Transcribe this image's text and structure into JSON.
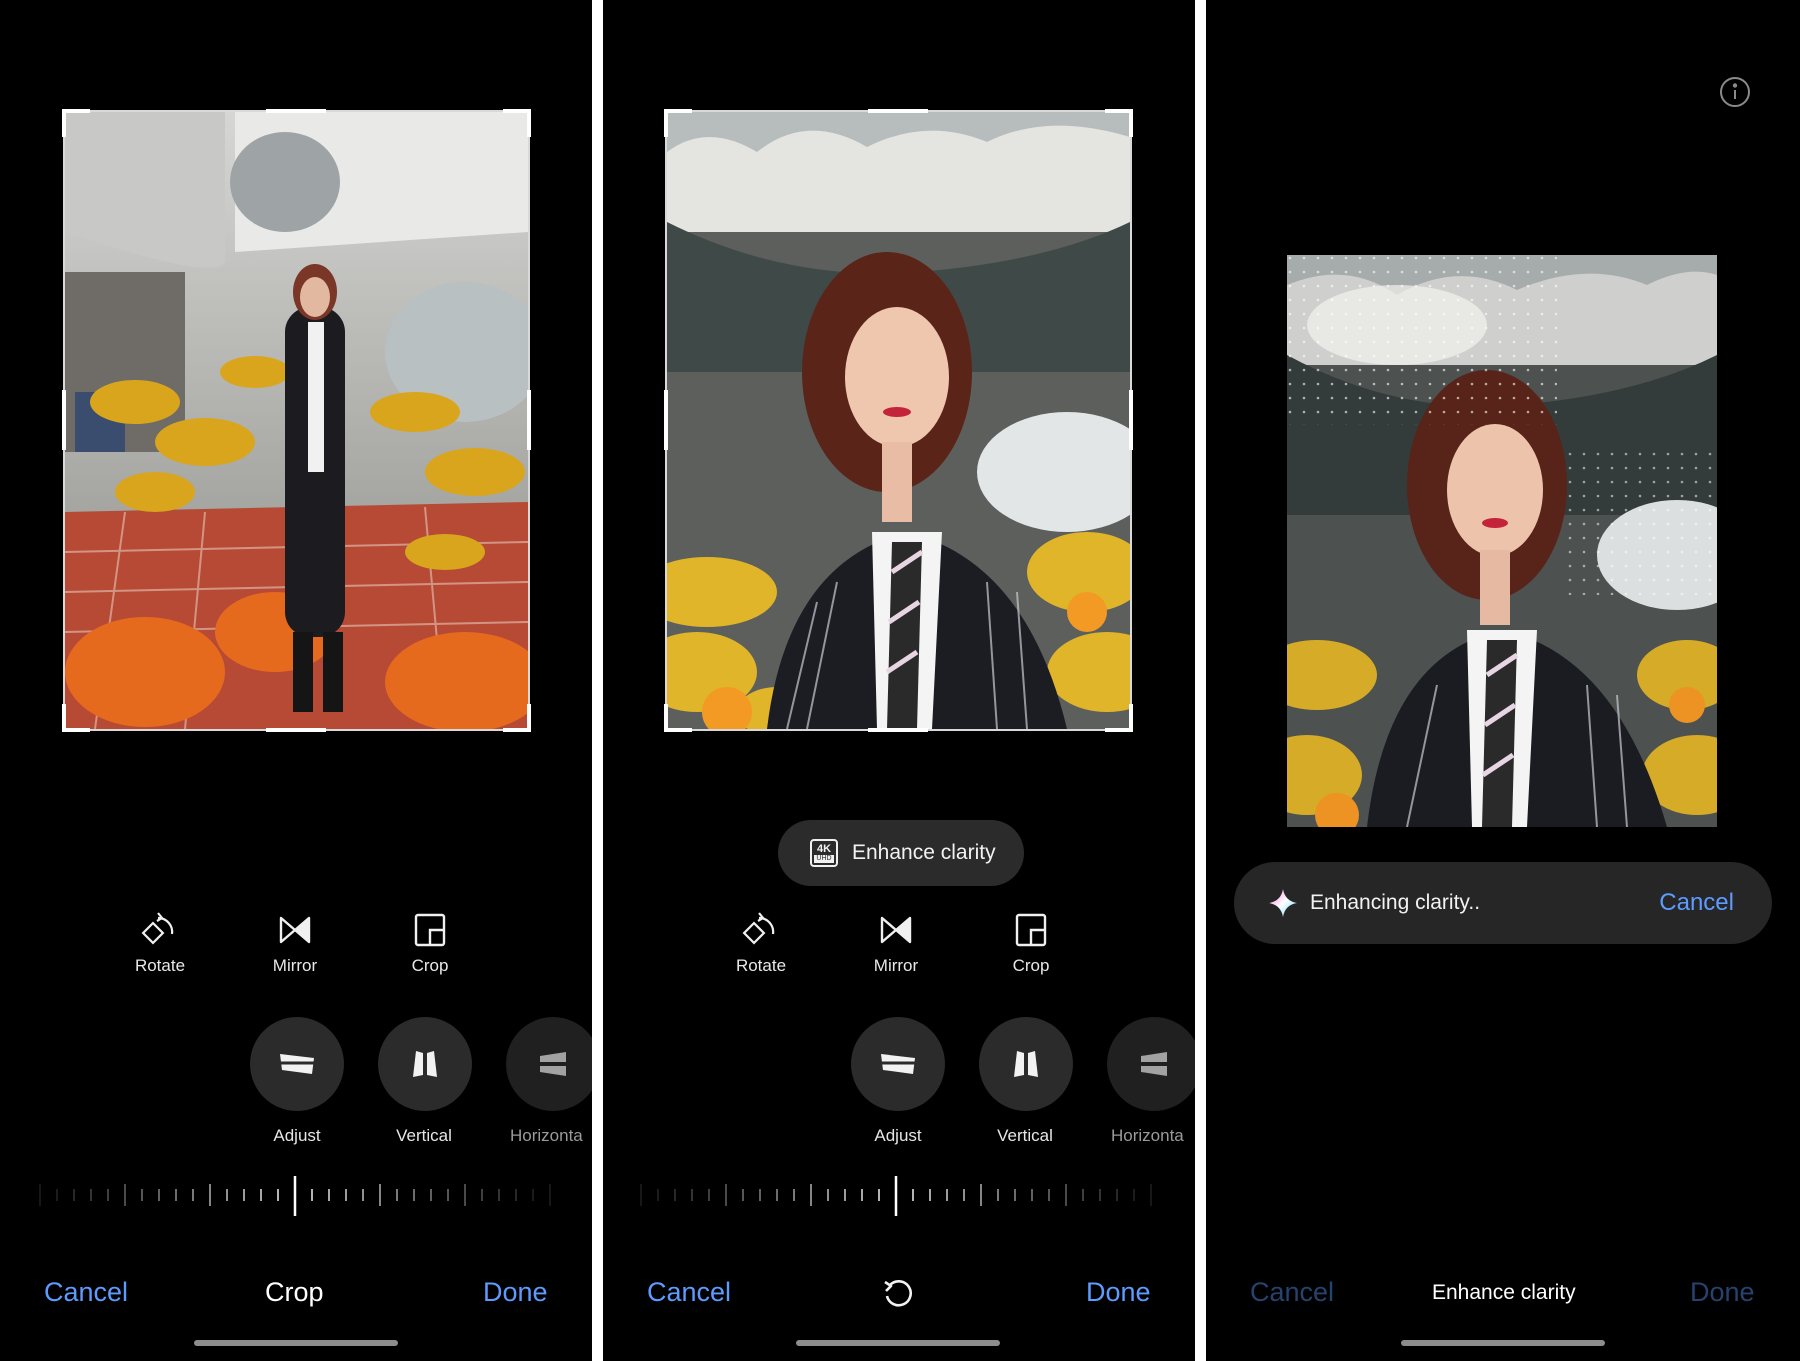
{
  "panel1": {
    "tools": {
      "rotate": "Rotate",
      "mirror": "Mirror",
      "crop": "Crop"
    },
    "modes": {
      "adjust": "Adjust",
      "vertical": "Vertical",
      "horizontal": "Horizonta"
    },
    "bottom": {
      "cancel": "Cancel",
      "title": "Crop",
      "done": "Done"
    }
  },
  "panel2": {
    "enhance_pill": {
      "badge_top": "4K",
      "badge_bottom": "UHD",
      "label": "Enhance clarity"
    },
    "tools": {
      "rotate": "Rotate",
      "mirror": "Mirror",
      "crop": "Crop"
    },
    "modes": {
      "adjust": "Adjust",
      "vertical": "Vertical",
      "horizontal": "Horizonta"
    },
    "bottom": {
      "cancel": "Cancel",
      "reset_icon": "reset-rotate-icon",
      "done": "Done"
    }
  },
  "panel3": {
    "info_icon": "info-icon",
    "status": {
      "icon": "sparkle-icon",
      "text": "Enhancing clarity..",
      "cancel": "Cancel"
    },
    "bottom": {
      "cancel": "Cancel",
      "title": "Enhance clarity",
      "done": "Done"
    }
  },
  "colors": {
    "accent": "#5d9bff",
    "accent_disabled": "#26426e",
    "panel_bg": "#000000",
    "pill_bg": "#2b2b2b"
  }
}
